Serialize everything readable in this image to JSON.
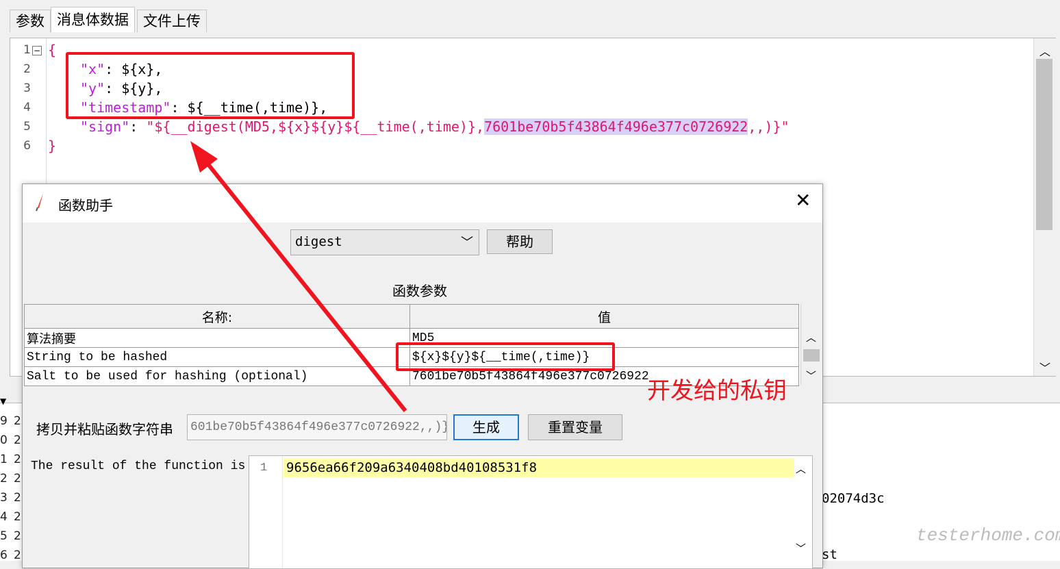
{
  "tabs": [
    "参数",
    "消息体数据",
    "文件上传"
  ],
  "editor": {
    "line_numbers": [
      "1",
      "2",
      "3",
      "4",
      "5",
      "6"
    ],
    "lines": {
      "l1": "{",
      "l2_key": "\"x\"",
      "l2_rest": ": ${x},",
      "l3_key": "\"y\"",
      "l3_rest": ": ${y},",
      "l4_key": "\"timestamp\"",
      "l4_rest": ": ${__time(,time)},",
      "l5_key": "\"sign\"",
      "l5_colon": ": ",
      "l5_value_a": "\"${__digest(MD5,${x}${y}${__time(,time)},",
      "l5_value_hl": "7601be70b5f43864f496e377c0726922",
      "l5_value_b": ",,)}\"",
      "l6": "}"
    }
  },
  "background_lines": {
    "numbers": [
      "9",
      "0",
      "1",
      "2",
      "3",
      "4",
      "5",
      "6"
    ],
    "col2": [
      "2",
      "2",
      "2",
      "2",
      "2",
      "2",
      "2",
      "2"
    ],
    "partial_right": "02074d3c",
    "partial_bottom": "st"
  },
  "dialog": {
    "title": "函数助手",
    "function_select": "digest",
    "help_button": "帮助",
    "params_heading": "函数参数",
    "table": {
      "headers": [
        "名称:",
        "值"
      ],
      "rows": [
        [
          "算法摘要",
          "MD5"
        ],
        [
          "String to be hashed",
          "${x}${y}${__time(,time)}"
        ],
        [
          "Salt to be used for hashing (optional)",
          "7601be70b5f43864f496e377c0726922"
        ]
      ]
    },
    "copy_label": "拷贝并粘贴函数字符串",
    "copy_value": "601be70b5f43864f496e377c0726922,,)}",
    "generate_button": "生成",
    "reset_button": "重置变量",
    "result_label": "The result of the function is",
    "result_line_number": "1",
    "result_value": "9656ea66f209a6340408bd40108531f8"
  },
  "annotation": {
    "note": "开发给的私钥"
  },
  "watermark": "testerhome.com",
  "colors": {
    "annotation_red": "#f0141e",
    "json_key": "#c01be0",
    "json_value": "#e0176d",
    "result_highlight": "#ffffa8"
  }
}
